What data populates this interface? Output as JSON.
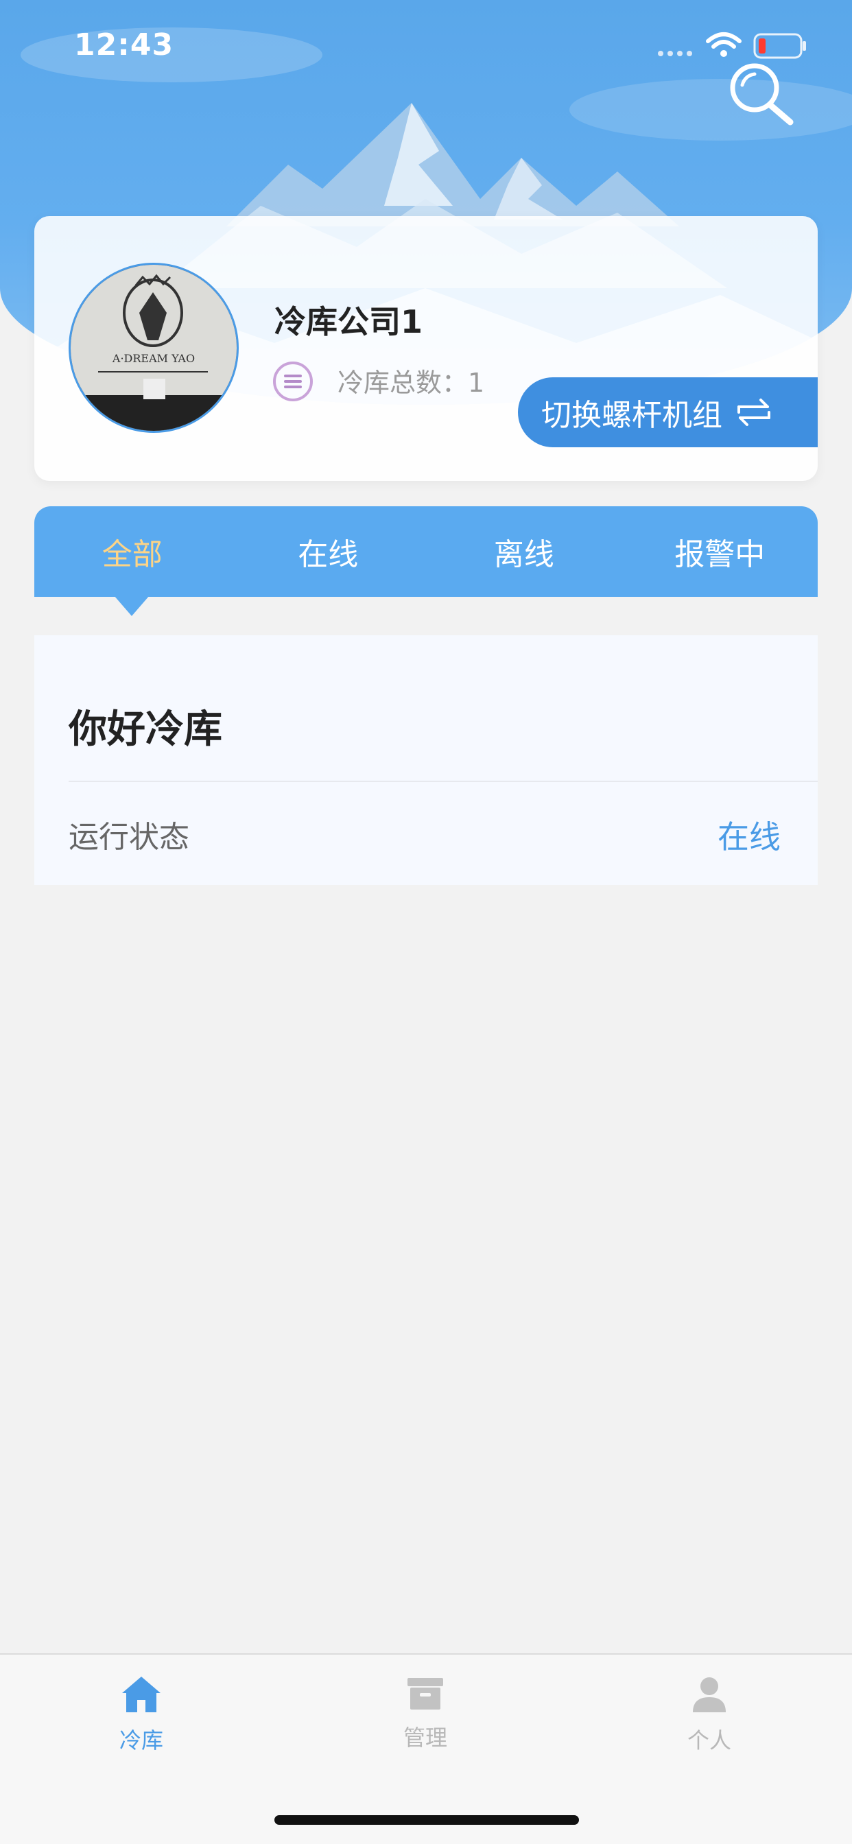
{
  "status_bar": {
    "time": "12:43"
  },
  "header": {
    "search_icon": "search-icon"
  },
  "company": {
    "name": "冷库公司1",
    "count_text": "冷库总数：1",
    "switch_label": "切换螺杆机组",
    "avatar_logo_text": "A·DREAM YAO"
  },
  "tabs": [
    {
      "label": "全部",
      "active": true
    },
    {
      "label": "在线",
      "active": false
    },
    {
      "label": "离线",
      "active": false
    },
    {
      "label": "报警中",
      "active": false
    }
  ],
  "list": [
    {
      "title": "你好冷库",
      "status_label": "运行状态",
      "status_value": "在线"
    }
  ],
  "bottom_nav": [
    {
      "label": "冷库",
      "icon": "home-icon",
      "active": true
    },
    {
      "label": "管理",
      "icon": "archive-icon",
      "active": false
    },
    {
      "label": "个人",
      "icon": "person-icon",
      "active": false
    }
  ],
  "colors": {
    "primary": "#4a9be6",
    "tab_bar": "#5aaaf0",
    "active_tab_text": "#fdd486",
    "switch_button": "#3f8fe0"
  }
}
